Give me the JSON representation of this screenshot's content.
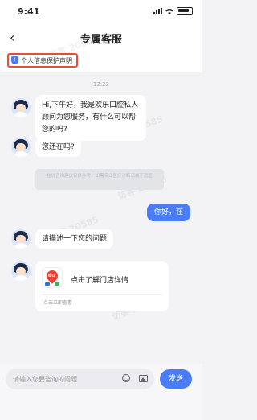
{
  "status_bar": {
    "time": "9:41"
  },
  "nav": {
    "back_icon": "chevron-left-icon",
    "title": "专属客服"
  },
  "privacy": {
    "label": "个人信息保护声明",
    "icon": "shield-icon"
  },
  "chat": {
    "timestamp": "12:22",
    "agent_greeting": "Hi,下午好，我是欢乐口腔私人顾问为您服务，有什么可以帮您的吗?",
    "agent_followup": "您还在吗?",
    "system_note": "在线咨询建议仅供参考，如需专业医疗诊断请线下就医",
    "user_message": "你好，在",
    "agent_ask": "请描述一下您的问题",
    "card": {
      "title": "点击了解门店详情",
      "footer": "点击立即查看",
      "icon_text": "du"
    }
  },
  "watermark": "访客 20585",
  "input": {
    "placeholder": "请输入您要咨询的问题",
    "send_label": "发送"
  },
  "colors": {
    "accent": "#4a7df5",
    "highlight_border": "#e74c3c",
    "background": "#f3f3f5"
  }
}
